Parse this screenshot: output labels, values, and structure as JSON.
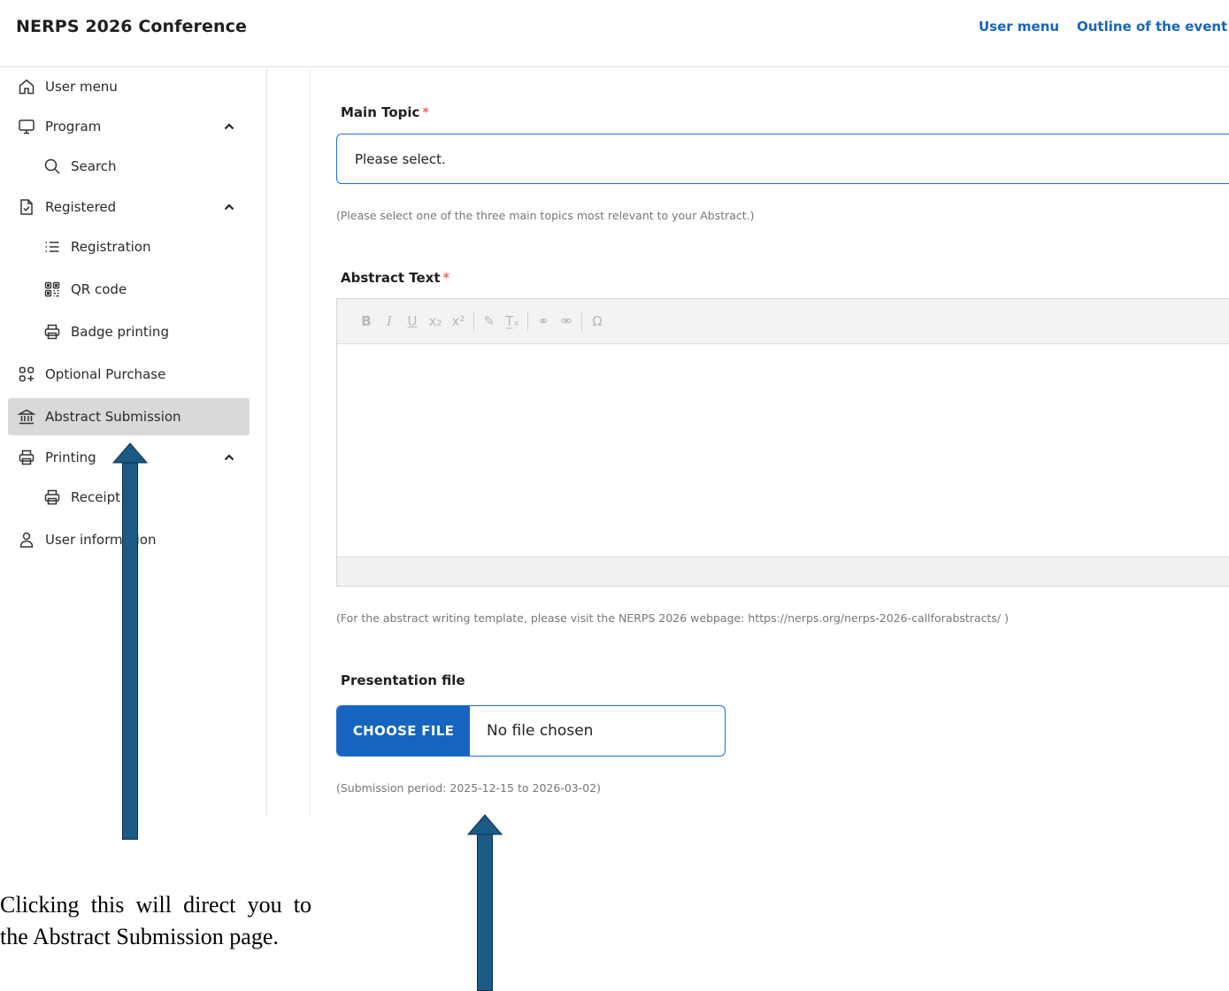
{
  "header": {
    "title": "NERPS 2026 Conference",
    "links": [
      "User menu",
      "Outline of the event"
    ]
  },
  "sidebar": {
    "items": [
      {
        "label": "User menu",
        "icon": "home-icon"
      },
      {
        "label": "Program",
        "icon": "monitor-icon",
        "expanded": true
      },
      {
        "label": "Search",
        "icon": "search-icon"
      },
      {
        "label": "Registered",
        "icon": "document-check-icon",
        "expanded": true
      },
      {
        "label": "Registration",
        "icon": "list-icon"
      },
      {
        "label": "QR code",
        "icon": "qr-code-icon"
      },
      {
        "label": "Badge printing",
        "icon": "printer-icon"
      },
      {
        "label": "Optional Purchase",
        "icon": "apps-add-icon"
      },
      {
        "label": "Abstract Submission",
        "icon": "institution-icon",
        "active": true
      },
      {
        "label": "Printing",
        "icon": "printer-icon",
        "expanded": true
      },
      {
        "label": "Receipt",
        "icon": "printer-icon"
      },
      {
        "label": "User information",
        "icon": "user-icon"
      }
    ]
  },
  "form": {
    "main_topic": {
      "label": "Main Topic",
      "required_mark": "*",
      "value": "Please select.",
      "hint": "(Please select one of the three main topics most relevant to your Abstract.)"
    },
    "abstract_text": {
      "label": "Abstract Text",
      "required_mark": "*",
      "toolbar": [
        "B",
        "I",
        "U",
        "x₂",
        "x²",
        "✎",
        "T̲ₓ",
        "⚭",
        "⚮",
        "Ω"
      ],
      "hint": "(For the abstract writing template, please visit the NERPS 2026 webpage: https://nerps.org/nerps-2026-callforabstracts/ )"
    },
    "presentation_file": {
      "label": "Presentation file",
      "button_label": "CHOOSE FILE",
      "status": "No file chosen",
      "hint": "(Submission period: 2025-12-15 to 2026-03-02)"
    }
  },
  "annotation": {
    "text": "Clicking this will direct you to the Abstract Submission page."
  },
  "colors": {
    "accent": "#1565c0",
    "arrow": "#1b5a85",
    "active_bg": "#d9d9d9",
    "required": "#e53935"
  }
}
